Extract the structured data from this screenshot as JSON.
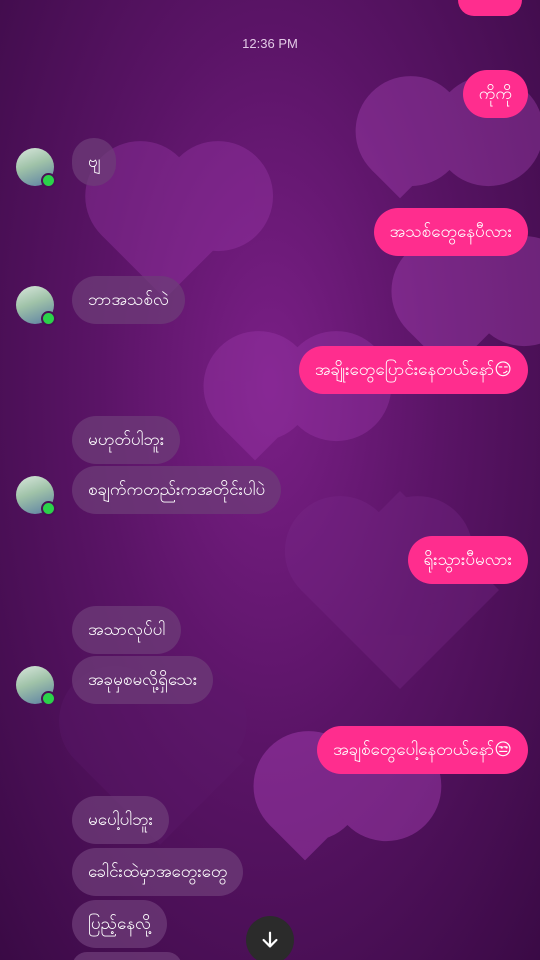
{
  "timestamp": "12:36 PM",
  "colors": {
    "outgoing": "#ff2d8e",
    "incoming": "#6e3c78",
    "online": "#2bd24a"
  },
  "messages": [
    {
      "side": "out",
      "text": "ကိုကို"
    },
    {
      "side": "in",
      "text": "ဗျ"
    },
    {
      "side": "out",
      "text": "အသစ်တွေနေပီလား"
    },
    {
      "side": "in",
      "text": "ဘာအသစ်လဲ"
    },
    {
      "side": "out",
      "text": "အချိုးတွေပြောင်းနေတယ်နော်😏"
    },
    {
      "side": "in",
      "text": "မဟုတ်ပါဘူး"
    },
    {
      "side": "in",
      "text": "စချက်ကတည်းကအတိုင်းပါပဲ"
    },
    {
      "side": "out",
      "text": "ရိုးသွားပီမလား"
    },
    {
      "side": "in",
      "text": "အသာလုပ်ပါ"
    },
    {
      "side": "in",
      "text": "အခုမှစမလို့ရှိသေး"
    },
    {
      "side": "out",
      "text": "အချစ်တွေပေါ့နေတယ်နော်😒"
    },
    {
      "side": "in",
      "text": "မပေါ့ပါဘူး"
    },
    {
      "side": "in",
      "text": "ခေါင်းထဲမှာအတွေးတွေ"
    },
    {
      "side": "in",
      "text": "ပြည့်နေလို့"
    }
  ],
  "scroll_button_icon": "arrow-down-icon"
}
